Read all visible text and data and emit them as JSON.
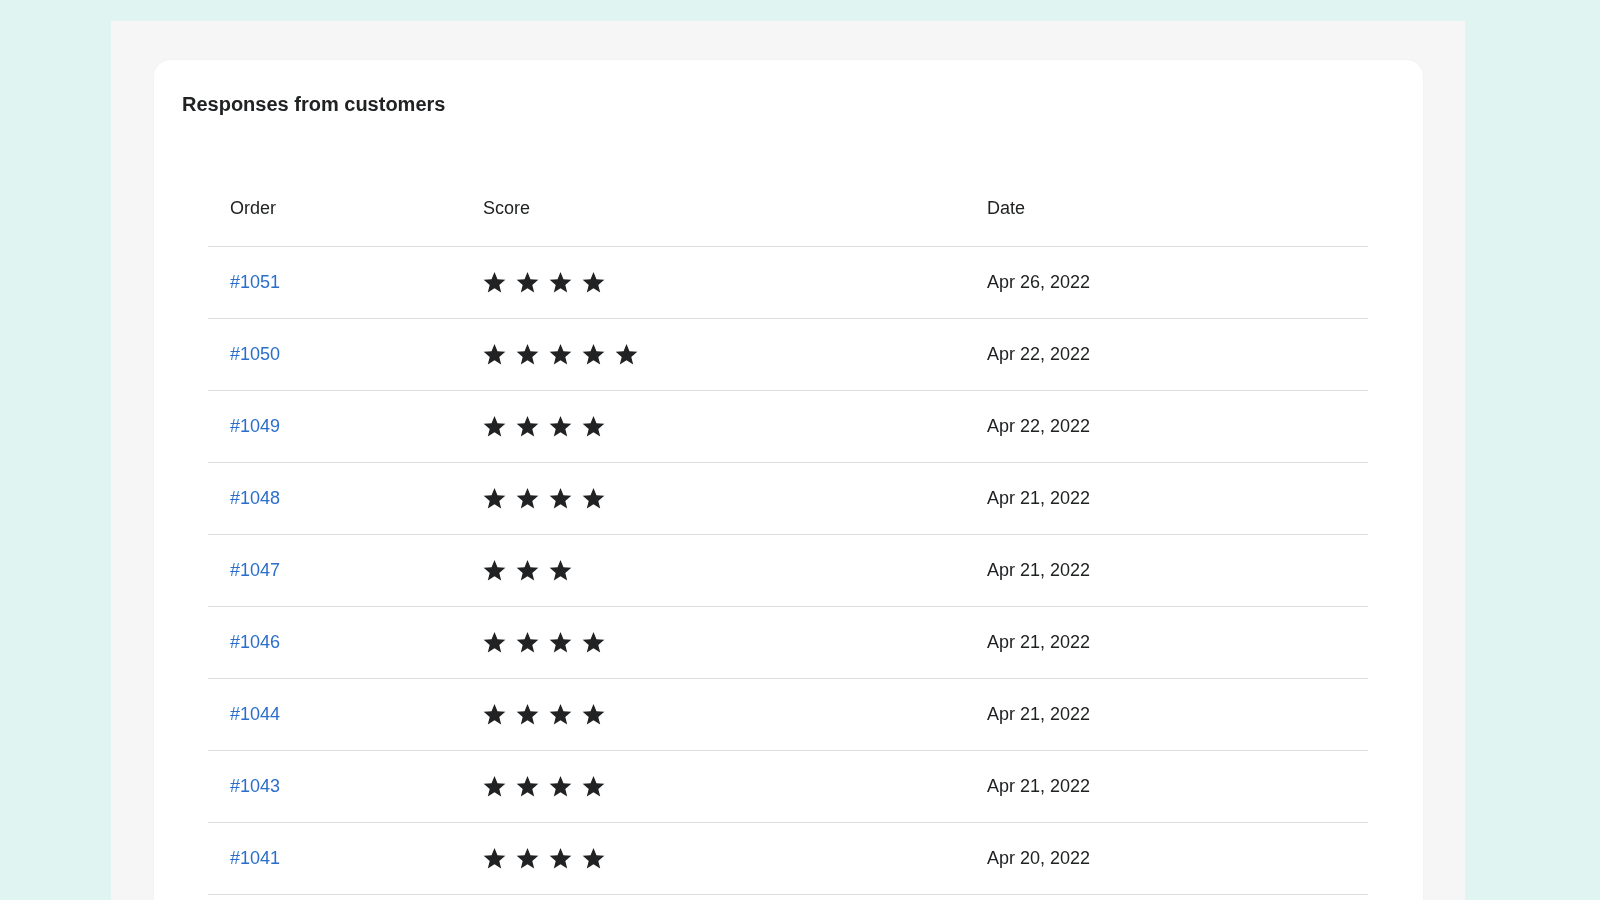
{
  "card": {
    "title": "Responses from customers"
  },
  "table": {
    "columns": [
      "Order",
      "Score",
      "Date"
    ],
    "rows": [
      {
        "order": "#1051",
        "stars": 4,
        "date": "Apr 26, 2022"
      },
      {
        "order": "#1050",
        "stars": 5,
        "date": "Apr 22, 2022"
      },
      {
        "order": "#1049",
        "stars": 4,
        "date": "Apr 22, 2022"
      },
      {
        "order": "#1048",
        "stars": 4,
        "date": "Apr 21, 2022"
      },
      {
        "order": "#1047",
        "stars": 3,
        "date": "Apr 21, 2022"
      },
      {
        "order": "#1046",
        "stars": 4,
        "date": "Apr 21, 2022"
      },
      {
        "order": "#1044",
        "stars": 4,
        "date": "Apr 21, 2022"
      },
      {
        "order": "#1043",
        "stars": 4,
        "date": "Apr 21, 2022"
      },
      {
        "order": "#1041",
        "stars": 4,
        "date": "Apr 20, 2022"
      }
    ]
  }
}
